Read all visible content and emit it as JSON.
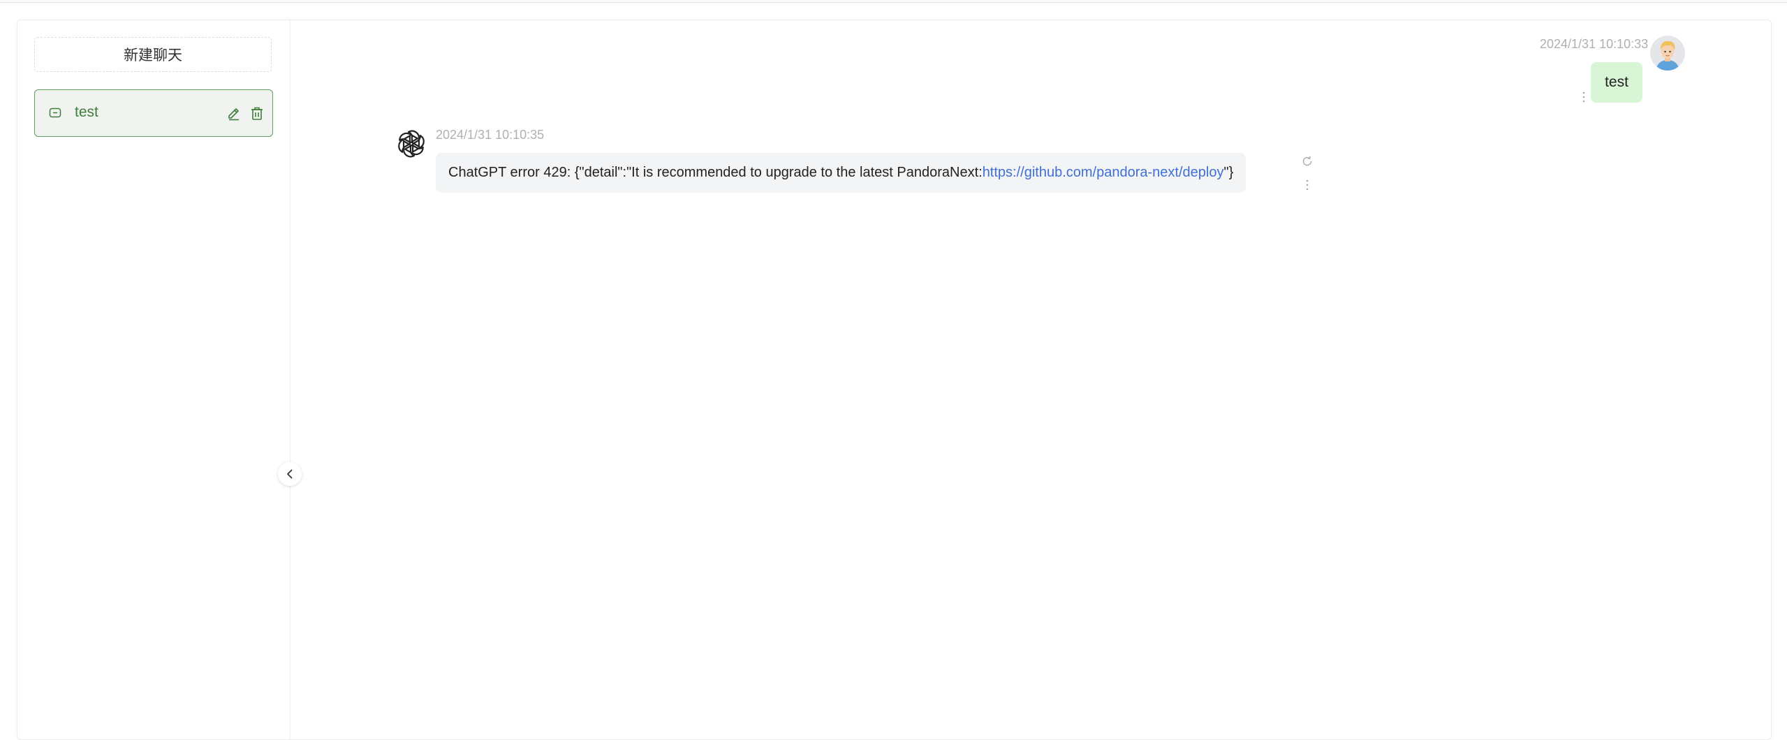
{
  "sidebar": {
    "new_chat_label": "新建聊天",
    "chats": [
      {
        "title": "test",
        "active": true
      }
    ]
  },
  "messages": [
    {
      "role": "user",
      "time": "2024/1/31 10:10:33",
      "text": "test"
    },
    {
      "role": "assistant",
      "time": "2024/1/31 10:10:35",
      "text_prefix": "ChatGPT error 429: {\"detail\":\"It is recommended to upgrade to the latest PandoraNext: ",
      "link_text": "https://github.com/pandora-next/deploy",
      "text_suffix": "\"}"
    }
  ],
  "colors": {
    "accent": "#3d7d3b",
    "user_bubble": "#d8f5d5",
    "bot_bubble": "#f3f4f6",
    "link": "#3f6fd4",
    "timestamp": "#b0b0b0"
  },
  "icons": {
    "chat_item": "chat-bubble-icon",
    "edit": "pencil-icon",
    "delete": "trash-icon",
    "collapse": "chevron-left-icon",
    "refresh": "refresh-icon",
    "more": "more-vertical-icon",
    "bot_avatar": "openai-logo-icon",
    "user_avatar": "user-avatar"
  }
}
